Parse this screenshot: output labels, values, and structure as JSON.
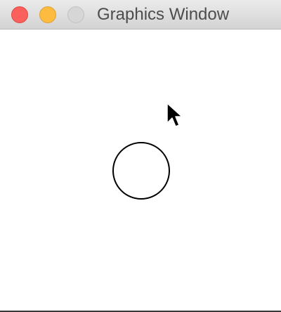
{
  "window": {
    "title": "Graphics Window"
  },
  "titlebar": {
    "buttons": {
      "close": "close-button",
      "minimize": "minimize-button",
      "maximize": "maximize-button"
    }
  },
  "canvas": {
    "shapes": [
      {
        "type": "circle",
        "stroke": "#000000",
        "fill": "none"
      }
    ]
  },
  "colors": {
    "close": "#fc605c",
    "minimize": "#fdbc40",
    "maximize": "#d6d6d6",
    "title_text": "#4d4d4d",
    "canvas_bg": "#ffffff"
  }
}
